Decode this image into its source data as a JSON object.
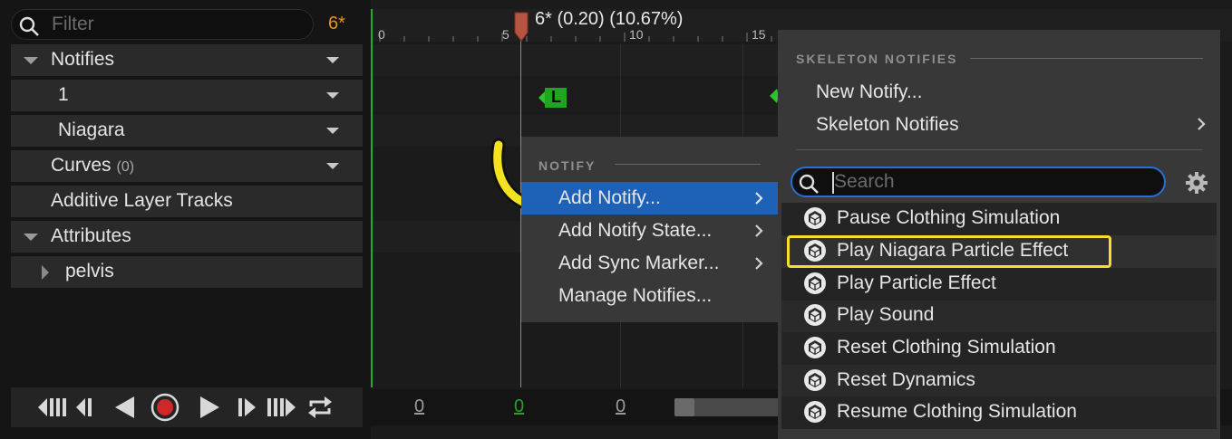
{
  "left": {
    "filter_placeholder": "Filter",
    "count": "6*",
    "tracks": [
      {
        "label": "Notifies",
        "sub": ""
      },
      {
        "label": "1",
        "sub": ""
      },
      {
        "label": "Niagara",
        "sub": ""
      },
      {
        "label": "Curves",
        "sub": "(0)"
      },
      {
        "label": "Additive Layer Tracks",
        "sub": ""
      },
      {
        "label": "Attributes",
        "sub": ""
      },
      {
        "label": "pelvis",
        "sub": ""
      }
    ]
  },
  "timeline": {
    "ticks": [
      "0",
      "5",
      "10",
      "15"
    ],
    "current_time": "6* (0.20) (10.67%)",
    "notify_marker": "L",
    "frames": [
      "0",
      "0",
      "0"
    ]
  },
  "notify_menu": {
    "header": "NOTIFY",
    "items": [
      {
        "label": "Add Notify...",
        "submenu": true
      },
      {
        "label": "Add Notify State...",
        "submenu": true
      },
      {
        "label": "Add Sync Marker...",
        "submenu": true
      },
      {
        "label": "Manage Notifies...",
        "submenu": false
      }
    ]
  },
  "skeleton_menu": {
    "header": "SKELETON NOTIFIES",
    "new_notify": "New Notify...",
    "skeleton_notifies": "Skeleton Notifies",
    "search_placeholder": "Search",
    "items": [
      "Pause Clothing Simulation",
      "Play Niagara Particle Effect",
      "Play Particle Effect",
      "Play Sound",
      "Reset Clothing Simulation",
      "Reset Dynamics",
      "Resume Clothing Simulation"
    ]
  },
  "colors": {
    "accent_blue": "#1e62b8",
    "highlight_yellow": "#f2e02a",
    "count_orange": "#e8941a",
    "timeline_green": "#22b022"
  }
}
